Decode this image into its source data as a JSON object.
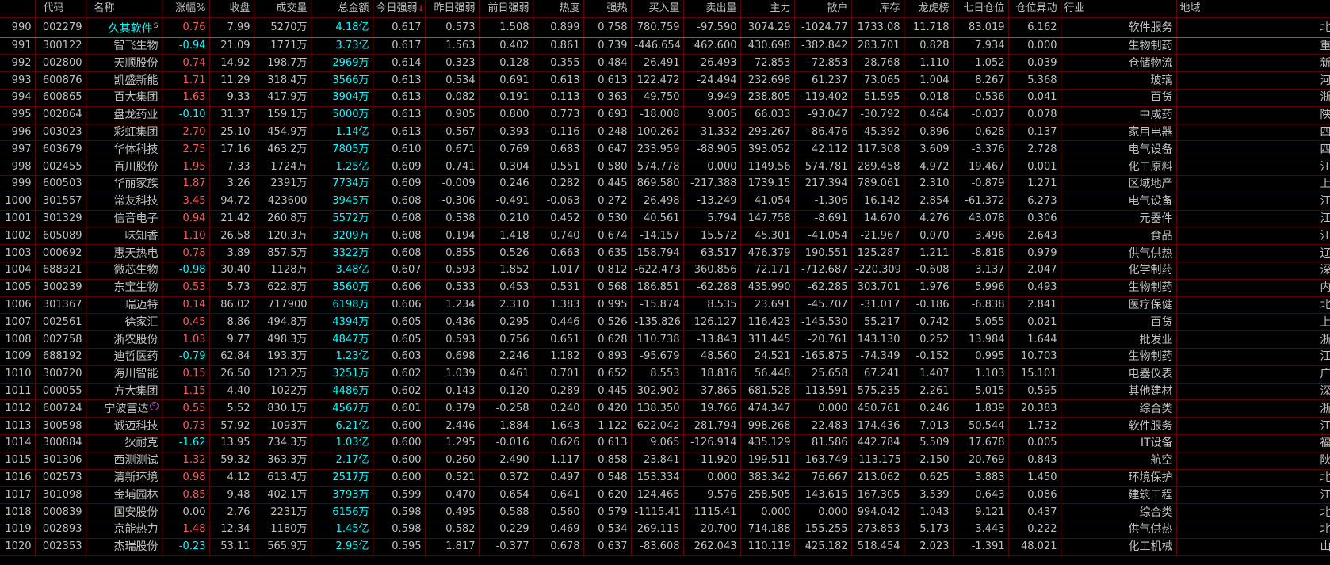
{
  "headers": [
    "",
    "代码",
    "名称",
    "涨幅%",
    "收盘",
    "成交量",
    "总金额",
    "今日强弱",
    "昨日强弱",
    "前日强弱",
    "热度",
    "强热",
    "买入量",
    "卖出量",
    "主力",
    "散户",
    "库存",
    "龙虎榜",
    "七日仓位",
    "仓位异动",
    "行业",
    "地域"
  ],
  "sort_indicator": "↓",
  "rows": [
    [
      "990",
      "002279",
      "久其软件",
      "0.76",
      "7.99",
      "5270万",
      "4.18亿",
      "0.617",
      "0.573",
      "1.508",
      "0.899",
      "0.758",
      "780.759",
      "-97.590",
      "3074.29",
      "-1024.77",
      "1733.08",
      "11.718",
      "83.019",
      "6.162",
      "软件服务",
      "北京板块"
    ],
    [
      "991",
      "300122",
      "智飞生物",
      "-0.94",
      "21.09",
      "1771万",
      "3.73亿",
      "0.617",
      "1.563",
      "0.402",
      "0.861",
      "0.739",
      "-446.654",
      "462.600",
      "430.698",
      "-382.842",
      "283.701",
      "0.828",
      "7.934",
      "0.000",
      "生物制药",
      "重庆板块"
    ],
    [
      "992",
      "002800",
      "天顺股份",
      "0.74",
      "14.92",
      "198.7万",
      "2969万",
      "0.614",
      "0.323",
      "0.128",
      "0.355",
      "0.484",
      "-26.491",
      "26.493",
      "72.853",
      "-72.853",
      "28.768",
      "1.110",
      "-1.052",
      "0.039",
      "仓储物流",
      "新疆板块"
    ],
    [
      "993",
      "600876",
      "凯盛新能",
      "1.71",
      "11.29",
      "318.4万",
      "3566万",
      "0.613",
      "0.534",
      "0.691",
      "0.613",
      "0.613",
      "122.472",
      "-24.494",
      "232.698",
      "61.237",
      "73.065",
      "1.004",
      "8.267",
      "5.368",
      "玻璃",
      "河南板块"
    ],
    [
      "994",
      "600865",
      "百大集团",
      "1.63",
      "9.33",
      "417.9万",
      "3904万",
      "0.613",
      "-0.082",
      "-0.191",
      "0.113",
      "0.363",
      "49.750",
      "-9.949",
      "238.805",
      "-119.402",
      "51.595",
      "0.018",
      "-0.536",
      "0.041",
      "百货",
      "浙江板块"
    ],
    [
      "995",
      "002864",
      "盘龙药业",
      "-0.10",
      "31.37",
      "159.1万",
      "5000万",
      "0.613",
      "0.905",
      "0.800",
      "0.773",
      "0.693",
      "-18.008",
      "9.005",
      "66.033",
      "-93.047",
      "-30.792",
      "0.464",
      "-0.037",
      "0.078",
      "中成药",
      "陕西板块"
    ],
    [
      "996",
      "003023",
      "彩虹集团",
      "2.70",
      "25.10",
      "454.9万",
      "1.14亿",
      "0.613",
      "-0.567",
      "-0.393",
      "-0.116",
      "0.248",
      "100.262",
      "-31.332",
      "293.267",
      "-86.476",
      "45.392",
      "0.896",
      "0.628",
      "0.137",
      "家用电器",
      "四川板块"
    ],
    [
      "997",
      "603679",
      "华体科技",
      "2.75",
      "17.16",
      "463.2万",
      "7805万",
      "0.610",
      "0.671",
      "0.769",
      "0.683",
      "0.647",
      "233.959",
      "-88.905",
      "393.052",
      "42.112",
      "117.308",
      "3.609",
      "-3.376",
      "2.728",
      "电气设备",
      "四川板块"
    ],
    [
      "998",
      "002455",
      "百川股份",
      "1.95",
      "7.33",
      "1724万",
      "1.25亿",
      "0.609",
      "0.741",
      "0.304",
      "0.551",
      "0.580",
      "574.778",
      "0.000",
      "1149.56",
      "574.781",
      "289.458",
      "4.972",
      "19.467",
      "0.001",
      "化工原料",
      "江苏板块"
    ],
    [
      "999",
      "600503",
      "华丽家族",
      "1.87",
      "3.26",
      "2391万",
      "7734万",
      "0.609",
      "-0.009",
      "0.246",
      "0.282",
      "0.445",
      "869.580",
      "-217.388",
      "1739.15",
      "217.394",
      "789.061",
      "2.310",
      "-0.879",
      "1.271",
      "区域地产",
      "上海板块"
    ],
    [
      "1000",
      "301557",
      "常友科技",
      "3.45",
      "94.72",
      "423600",
      "3945万",
      "0.608",
      "-0.306",
      "-0.491",
      "-0.063",
      "0.272",
      "26.498",
      "-13.249",
      "41.054",
      "-1.306",
      "16.142",
      "2.854",
      "-61.372",
      "6.273",
      "电气设备",
      "江苏板块"
    ],
    [
      "1001",
      "301329",
      "信音电子",
      "0.94",
      "21.42",
      "260.8万",
      "5572万",
      "0.608",
      "0.538",
      "0.210",
      "0.452",
      "0.530",
      "40.561",
      "5.794",
      "147.758",
      "-8.691",
      "14.670",
      "4.276",
      "43.078",
      "0.306",
      "元器件",
      "江苏板块"
    ],
    [
      "1002",
      "605089",
      "味知香",
      "1.10",
      "26.58",
      "120.3万",
      "3209万",
      "0.608",
      "0.194",
      "1.418",
      "0.740",
      "0.674",
      "-14.157",
      "15.572",
      "45.301",
      "-41.054",
      "-21.967",
      "0.070",
      "3.496",
      "2.643",
      "食品",
      "江苏板块"
    ],
    [
      "1003",
      "000692",
      "惠天热电",
      "0.78",
      "3.89",
      "857.5万",
      "3322万",
      "0.608",
      "0.855",
      "0.526",
      "0.663",
      "0.635",
      "158.794",
      "63.517",
      "476.379",
      "190.551",
      "125.287",
      "1.211",
      "-8.818",
      "0.979",
      "供气供热",
      "辽宁板块"
    ],
    [
      "1004",
      "688321",
      "微芯生物",
      "-0.98",
      "30.40",
      "1128万",
      "3.48亿",
      "0.607",
      "0.593",
      "1.852",
      "1.017",
      "0.812",
      "-622.473",
      "360.856",
      "72.171",
      "-712.687",
      "-220.309",
      "-0.608",
      "3.137",
      "2.047",
      "化学制药",
      "深圳板块"
    ],
    [
      "1005",
      "300239",
      "东宝生物",
      "0.53",
      "5.73",
      "622.8万",
      "3560万",
      "0.606",
      "0.533",
      "0.453",
      "0.531",
      "0.568",
      "186.851",
      "-62.288",
      "435.990",
      "-62.285",
      "303.701",
      "1.976",
      "5.996",
      "0.493",
      "生物制药",
      "内蒙板块"
    ],
    [
      "1006",
      "301367",
      "瑞迈特",
      "0.14",
      "86.02",
      "717900",
      "6198万",
      "0.606",
      "1.234",
      "2.310",
      "1.383",
      "0.995",
      "-15.874",
      "8.535",
      "23.691",
      "-45.707",
      "-31.017",
      "-0.186",
      "-6.838",
      "2.841",
      "医疗保健",
      "北京板块"
    ],
    [
      "1007",
      "002561",
      "徐家汇",
      "0.45",
      "8.86",
      "494.8万",
      "4394万",
      "0.605",
      "0.436",
      "0.295",
      "0.446",
      "0.526",
      "-135.826",
      "126.127",
      "116.423",
      "-145.530",
      "55.217",
      "0.742",
      "5.055",
      "0.021",
      "百货",
      "上海板块"
    ],
    [
      "1008",
      "002758",
      "浙农股份",
      "1.03",
      "9.77",
      "498.3万",
      "4847万",
      "0.605",
      "0.593",
      "0.756",
      "0.651",
      "0.628",
      "110.738",
      "-13.843",
      "311.445",
      "-20.761",
      "143.130",
      "0.252",
      "13.984",
      "1.644",
      "批发业",
      "浙江板块"
    ],
    [
      "1009",
      "688192",
      "迪哲医药",
      "-0.79",
      "62.84",
      "193.3万",
      "1.23亿",
      "0.603",
      "0.698",
      "2.246",
      "1.182",
      "0.893",
      "-95.679",
      "48.560",
      "24.521",
      "-165.875",
      "-74.349",
      "-0.152",
      "0.995",
      "10.703",
      "生物制药",
      "江苏板块"
    ],
    [
      "1010",
      "300720",
      "海川智能",
      "0.15",
      "26.50",
      "123.2万",
      "3251万",
      "0.602",
      "1.039",
      "0.461",
      "0.701",
      "0.652",
      "8.553",
      "18.816",
      "56.448",
      "25.658",
      "67.241",
      "1.407",
      "1.103",
      "15.101",
      "电器仪表",
      "广东板块"
    ],
    [
      "1011",
      "000055",
      "方大集团",
      "1.15",
      "4.40",
      "1022万",
      "4486万",
      "0.602",
      "0.143",
      "0.120",
      "0.289",
      "0.445",
      "302.902",
      "-37.865",
      "681.528",
      "113.591",
      "575.235",
      "2.261",
      "5.015",
      "0.595",
      "其他建材",
      "深圳板块"
    ],
    [
      "1012",
      "600724",
      "宁波富达",
      "0.55",
      "5.52",
      "830.1万",
      "4567万",
      "0.601",
      "0.379",
      "-0.258",
      "0.240",
      "0.420",
      "138.350",
      "19.766",
      "474.347",
      "0.000",
      "450.761",
      "0.246",
      "1.839",
      "20.383",
      "综合类",
      "浙江板块"
    ],
    [
      "1013",
      "300598",
      "诚迈科技",
      "0.73",
      "57.92",
      "1093万",
      "6.21亿",
      "0.600",
      "2.446",
      "1.884",
      "1.643",
      "1.122",
      "622.042",
      "-281.794",
      "998.268",
      "22.483",
      "174.436",
      "7.013",
      "50.544",
      "1.732",
      "软件服务",
      "江苏板块"
    ],
    [
      "1014",
      "300884",
      "狄耐克",
      "-1.62",
      "13.95",
      "734.3万",
      "1.03亿",
      "0.600",
      "1.295",
      "-0.016",
      "0.626",
      "0.613",
      "9.065",
      "-126.914",
      "435.129",
      "81.586",
      "442.784",
      "5.509",
      "17.678",
      "0.005",
      "IT设备",
      "福建板块"
    ],
    [
      "1015",
      "301306",
      "西测测试",
      "1.32",
      "59.32",
      "363.3万",
      "2.17亿",
      "0.600",
      "0.260",
      "2.490",
      "1.117",
      "0.858",
      "23.841",
      "-11.920",
      "199.511",
      "-163.749",
      "-113.175",
      "-2.150",
      "20.769",
      "0.843",
      "航空",
      "陕西板块"
    ],
    [
      "1016",
      "002573",
      "清新环境",
      "0.98",
      "4.12",
      "613.4万",
      "2517万",
      "0.600",
      "0.521",
      "0.372",
      "0.497",
      "0.548",
      "153.334",
      "0.000",
      "383.342",
      "76.667",
      "213.062",
      "0.625",
      "3.883",
      "1.450",
      "环境保护",
      "北京板块"
    ],
    [
      "1017",
      "301098",
      "金埔园林",
      "0.85",
      "9.48",
      "402.1万",
      "3793万",
      "0.599",
      "0.470",
      "0.654",
      "0.641",
      "0.620",
      "124.465",
      "9.576",
      "258.505",
      "143.615",
      "167.305",
      "3.539",
      "0.643",
      "0.086",
      "建筑工程",
      "江苏板块"
    ],
    [
      "1018",
      "000839",
      "国安股份",
      "0.00",
      "2.76",
      "2231万",
      "6156万",
      "0.598",
      "0.495",
      "0.588",
      "0.560",
      "0.579",
      "-1115.41",
      "1115.41",
      "0.000",
      "0.000",
      "994.042",
      "1.043",
      "9.121",
      "0.437",
      "综合类",
      "北京板块"
    ],
    [
      "1019",
      "002893",
      "京能热力",
      "1.48",
      "12.34",
      "1180万",
      "1.45亿",
      "0.598",
      "0.582",
      "0.229",
      "0.469",
      "0.534",
      "269.115",
      "20.700",
      "714.188",
      "155.255",
      "273.853",
      "5.173",
      "3.443",
      "0.222",
      "供气供热",
      "北京板块"
    ],
    [
      "1020",
      "002353",
      "杰瑞股份",
      "-0.23",
      "53.11",
      "565.9万",
      "2.95亿",
      "0.595",
      "1.817",
      "-0.377",
      "0.678",
      "0.637",
      "-83.608",
      "262.043",
      "110.119",
      "425.182",
      "518.454",
      "2.023",
      "-1.391",
      "48.021",
      "化工机械",
      "山东板块"
    ]
  ],
  "row_marks": {
    "0": "S",
    "22": "S"
  },
  "selected_row": 0,
  "colors": {
    "up": "#ff5c5c",
    "down": "#00ffff",
    "flat": "#c0c0c0",
    "amount": "#00ffff",
    "grid": "#5a0000"
  }
}
